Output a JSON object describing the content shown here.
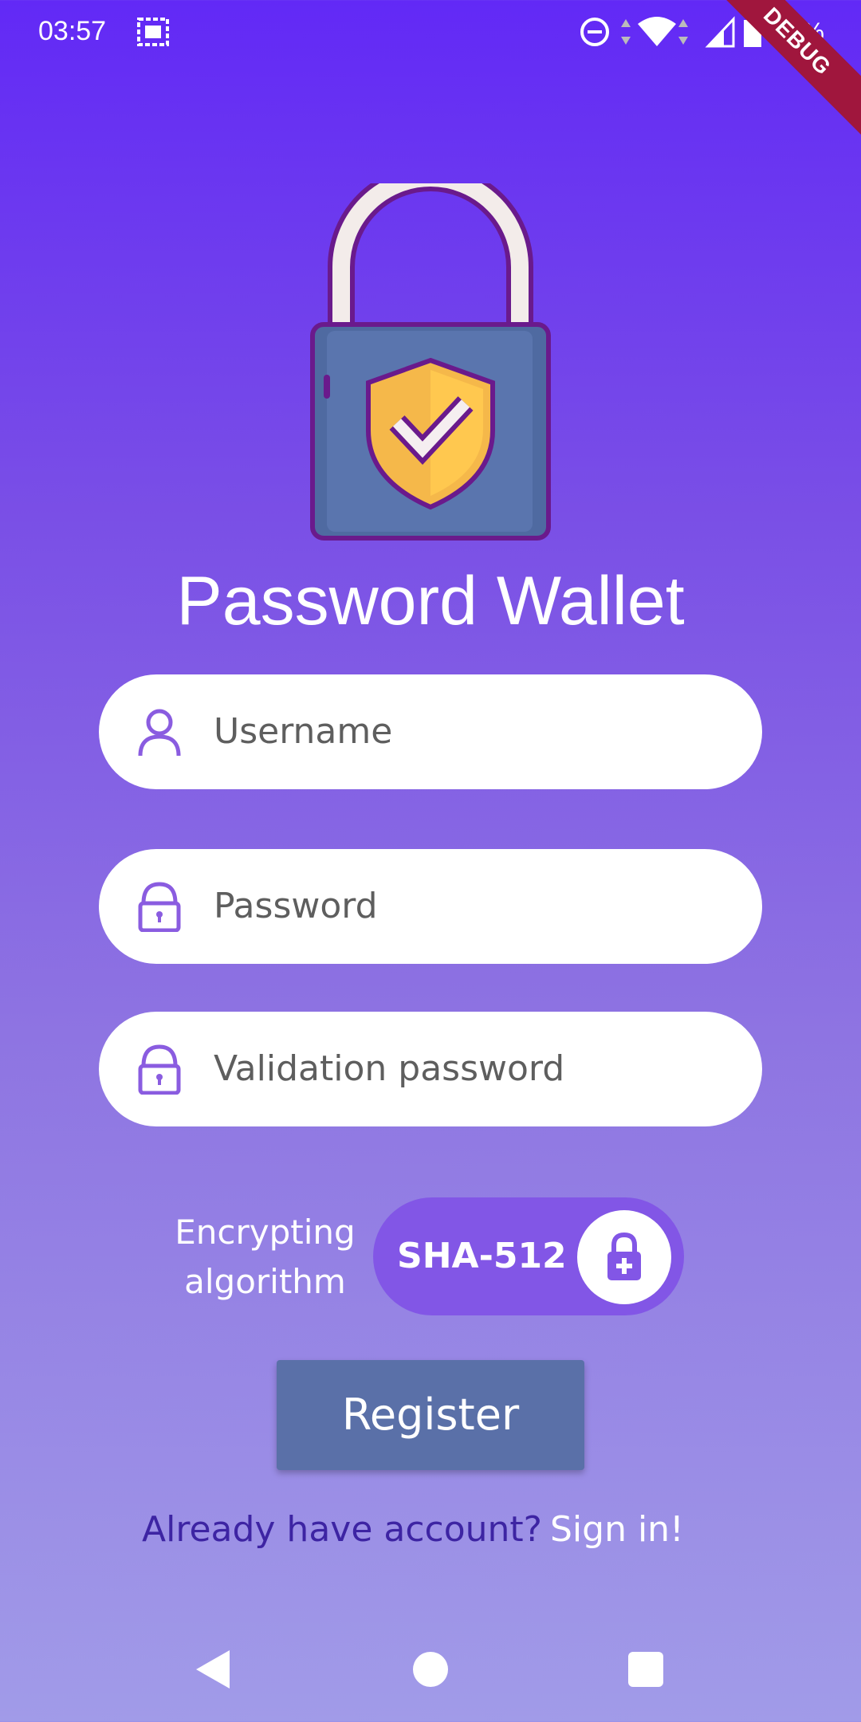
{
  "status_bar": {
    "time": "03:57",
    "battery": "84%",
    "debug_label": "DEBUG",
    "icons": [
      "gallery-icon",
      "dnd-icon",
      "wifi-icon",
      "cell-signal-icon",
      "battery-icon"
    ]
  },
  "app": {
    "title": "Password Wallet",
    "logo": "padlock-shield-icon"
  },
  "form": {
    "username_placeholder": "Username",
    "password_placeholder": "Password",
    "validation_placeholder": "Validation password",
    "algorithm_label_line1": "Encrypting",
    "algorithm_label_line2": "algorithm",
    "algorithm_value": "SHA-512",
    "register_label": "Register"
  },
  "footer": {
    "prompt": "Already have account?",
    "signin_label": "Sign in!"
  },
  "colors": {
    "gradient_top": "#6229f6",
    "gradient_bottom": "#a19be8",
    "accent": "#8256e6",
    "button": "#5a70a8",
    "prompt_text": "#3d24a3"
  }
}
